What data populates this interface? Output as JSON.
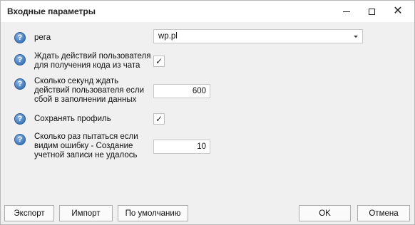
{
  "window": {
    "title": "Входные параметры",
    "controls": {
      "minimize": "minimize-icon",
      "maximize": "maximize-icon",
      "close": "close-icon"
    }
  },
  "params": [
    {
      "label": "рега",
      "type": "select",
      "value": "wp.pl"
    },
    {
      "label": "Ждать действий пользователя для получения кода из чата",
      "type": "checkbox",
      "checked": true
    },
    {
      "label": "Сколько секунд ждать действий пользователя если сбой в заполнении данных",
      "type": "number",
      "value": "600"
    },
    {
      "label": "Сохранять профиль",
      "type": "checkbox",
      "checked": true
    },
    {
      "label": "Сколько раз пытаться  если видим ошибку - Создание учетной записи не удалось",
      "type": "number",
      "value": "10"
    }
  ],
  "help_icon": "question-circle-icon",
  "footer": {
    "export_label": "Экспорт",
    "import_label": "Импорт",
    "defaults_label": "По умолчанию",
    "ok_label": "OK",
    "cancel_label": "Отмена"
  }
}
